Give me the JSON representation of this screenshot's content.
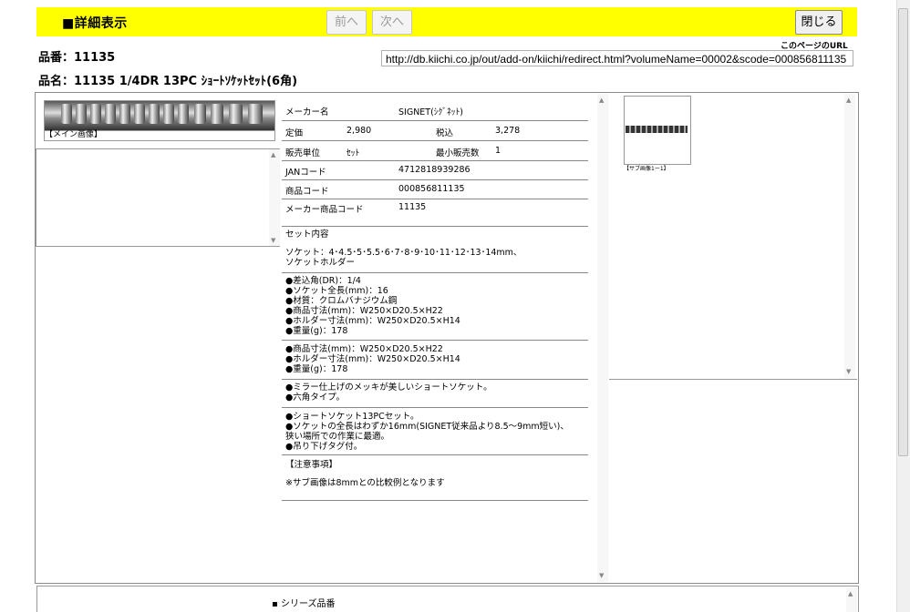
{
  "header": {
    "title": "■詳細表示",
    "prev_label": "前へ",
    "next_label": "次へ",
    "close_label": "閉じる",
    "url_label": "このページのURL",
    "url_value": "http://db.kiichi.co.jp/out/add-on/kiichi/redirect.html?volumeName=00002&scode=000856811135"
  },
  "product": {
    "hinban": "品番：11135",
    "hinmei": "品名：11135 1/4DR 13PC ｼｮｰﾄｿｹｯﾄｾｯﾄ(6角)"
  },
  "images": {
    "main_label": "【メイン画像】",
    "sub_label": "【サブ画像1ー1】"
  },
  "spec": {
    "maker_label": "メーカー名",
    "maker_value": "SIGNET(ｼｸﾞﾈｯﾄ)",
    "price_label": "定価",
    "price_value": "2,980",
    "tax_label": "税込",
    "tax_value": "3,278",
    "unit_label": "販売単位",
    "unit_value": "ｾｯﾄ",
    "min_label": "最小販売数",
    "min_value": "1",
    "jan_label": "JANコード",
    "jan_value": "4712818939286",
    "code_label": "商品コード",
    "code_value": "000856811135",
    "maker_code_label": "メーカー商品コード",
    "maker_code_value": "11135"
  },
  "details": {
    "set_title": "セット内容",
    "set_body": "ソケット：4･4.5･5･5.5･6･7･8･9･10･11･12･13･14mm、\nソケットホルダー",
    "spec_block": "●差込角(DR)：1/4\n●ソケット全長(mm)：16\n●材質：クロムバナジウム鋼\n●商品寸法(mm)：W250×D20.5×H22\n●ホルダー寸法(mm)：W250×D20.5×H14\n●重量(g)：178",
    "spec_block2": "●商品寸法(mm)：W250×D20.5×H22\n●ホルダー寸法(mm)：W250×D20.5×H14\n●重量(g)：178",
    "feature_block": "●ミラー仕上げのメッキが美しいショートソケット。\n●六角タイプ。",
    "feature_block2": "●ショートソケット13PCセット。\n●ソケットの全長はわずか16mm(SIGNET従来品より8.5～9mm短い)、\n狭い場所での作業に最適。\n●吊り下げタグ付。",
    "notes_title": "【注意事項】",
    "notes_body": "※サブ画像は8mmとの比較例となります"
  },
  "bottom": {
    "series_label": "シリーズ品番"
  }
}
